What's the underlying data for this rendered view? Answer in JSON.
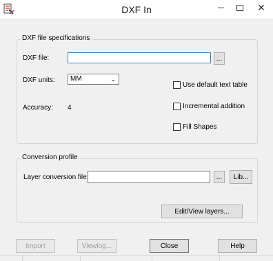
{
  "window": {
    "title": "DXF In",
    "icon": "dxf-app-icon",
    "minimize_icon": "minimize-icon",
    "maximize_icon": "maximize-icon",
    "close_glyph": "✕"
  },
  "spec_group": {
    "label": "DXF file specifications",
    "file_label": "DXF file:",
    "file_value": "",
    "browse_label": "...",
    "units_label": "DXF units:",
    "units_value": "MM",
    "accuracy_label": "Accuracy:",
    "accuracy_value": "4",
    "checkboxes": [
      {
        "label": "Use default text table",
        "checked": false
      },
      {
        "label": "Incremental addition",
        "checked": false
      },
      {
        "label": "Fill Shapes",
        "checked": false
      }
    ]
  },
  "profile_group": {
    "label": "Conversion profile",
    "layer_label": "Layer conversion file:",
    "layer_value": "",
    "browse_label": "...",
    "lib_label": "Lib...",
    "edit_layers_label": "Edit/View layers..."
  },
  "buttons": {
    "import": "Import",
    "viewlog": "Viewlog...",
    "close": "Close",
    "help": "Help"
  }
}
